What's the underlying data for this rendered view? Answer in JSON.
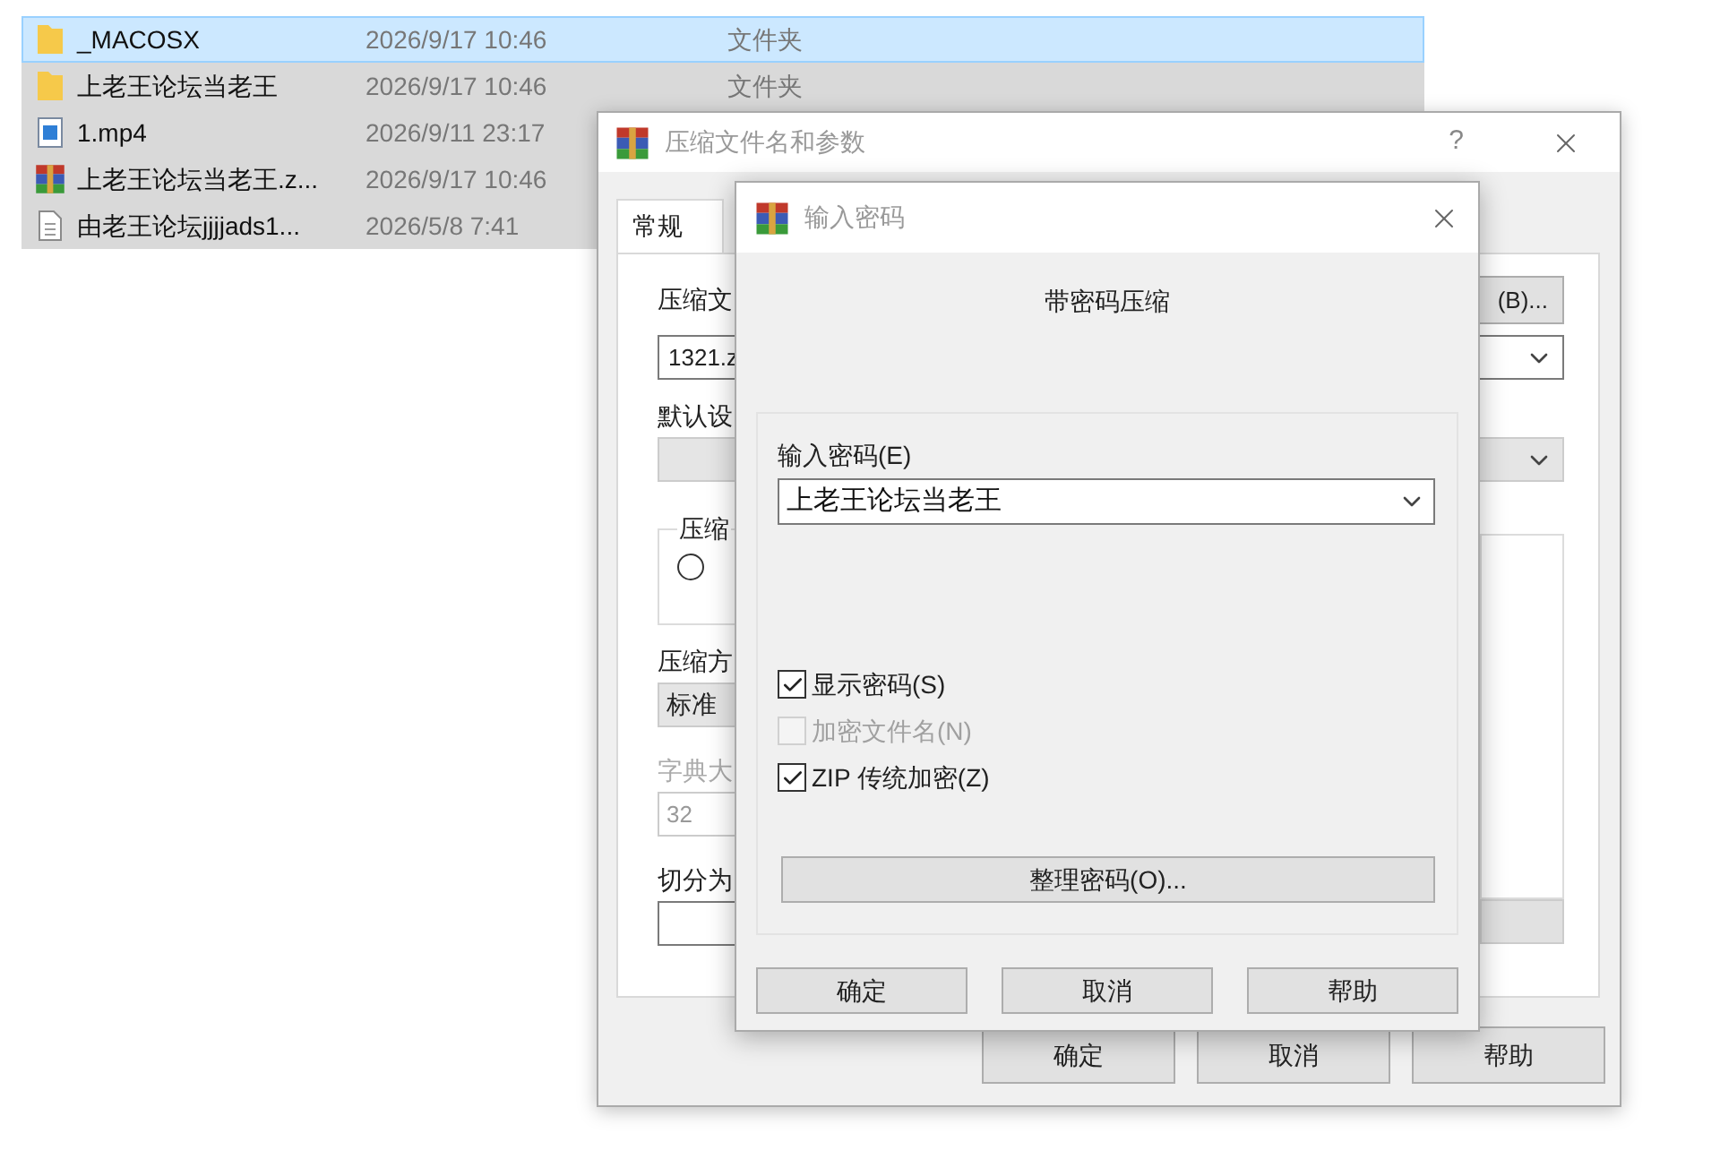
{
  "file_list": {
    "rows": [
      {
        "kind": "folder",
        "name": "_MACOSX",
        "date": "2026/9/17 10:46",
        "type": "文件夹",
        "focused": true
      },
      {
        "kind": "folder",
        "name": "上老王论坛当老王",
        "date": "2026/9/17 10:46",
        "type": "文件夹",
        "focused": false
      },
      {
        "kind": "video",
        "name": "1.mp4",
        "date": "2026/9/11 23:17",
        "focused": false
      },
      {
        "kind": "archive",
        "name": "上老王论坛当老王.z...",
        "date": "2026/9/17 10:46",
        "focused": false
      },
      {
        "kind": "text",
        "name": "由老王论坛jjjjads1...",
        "date": "2026/5/8 7:41",
        "focused": false
      }
    ]
  },
  "archive_dialog": {
    "title": "压缩文件名和参数",
    "help": "?",
    "tabs": [
      {
        "label": "常规",
        "selected": true
      }
    ],
    "name_label": "压缩文",
    "browse_button": "(B)...",
    "name_value": "1321.z",
    "profile_label": "默认设",
    "group_label": "压缩",
    "radio": {
      "selected": false
    },
    "method_label": "压缩方",
    "method_value": "标准",
    "dict_label": "字典大",
    "dict_value": "32",
    "split_label": "切分为",
    "buttons": [
      "确定",
      "取消",
      "帮助"
    ]
  },
  "password_dialog": {
    "title": "输入密码",
    "heading": "带密码压缩",
    "password_label": "输入密码(E)",
    "password_value": "上老王论坛当老王",
    "options": [
      {
        "label": "显示密码(S)",
        "checked": true,
        "disabled": false
      },
      {
        "label": "加密文件名(N)",
        "checked": false,
        "disabled": true
      },
      {
        "label": "ZIP 传统加密(Z)",
        "checked": true,
        "disabled": false
      }
    ],
    "organize_button": "整理密码(O)...",
    "buttons": [
      "确定",
      "取消",
      "帮助"
    ]
  }
}
